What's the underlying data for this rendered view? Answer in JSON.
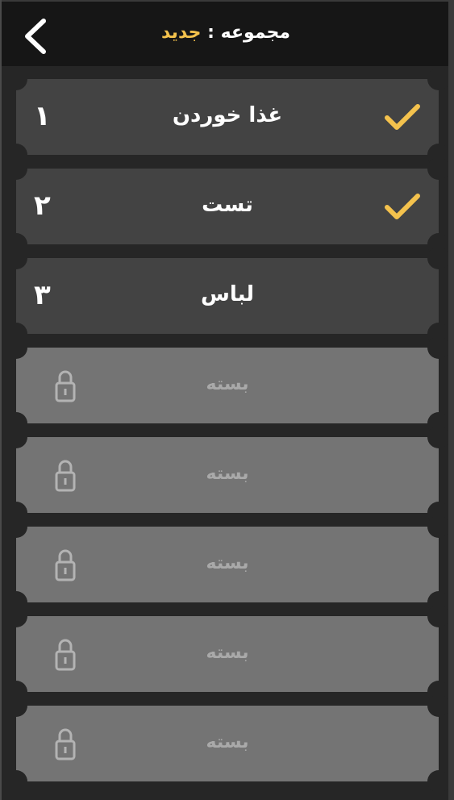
{
  "header": {
    "label": "مجموعه",
    "separator": " : ",
    "value": "جدید",
    "value_color": "#f4c24d",
    "back_icon": "chevron-left-icon"
  },
  "levels": [
    {
      "number": "۱",
      "name": "غذا خوردن",
      "state": "completed"
    },
    {
      "number": "۲",
      "name": "تست",
      "state": "completed"
    },
    {
      "number": "۳",
      "name": "لباس",
      "state": "open"
    },
    {
      "name": "بسته",
      "state": "locked"
    },
    {
      "name": "بسته",
      "state": "locked"
    },
    {
      "name": "بسته",
      "state": "locked"
    },
    {
      "name": "بسته",
      "state": "locked"
    },
    {
      "name": "بسته",
      "state": "locked"
    }
  ],
  "colors": {
    "check": "#f4c24d",
    "open_card": "#434343",
    "locked_card": "#747474"
  }
}
